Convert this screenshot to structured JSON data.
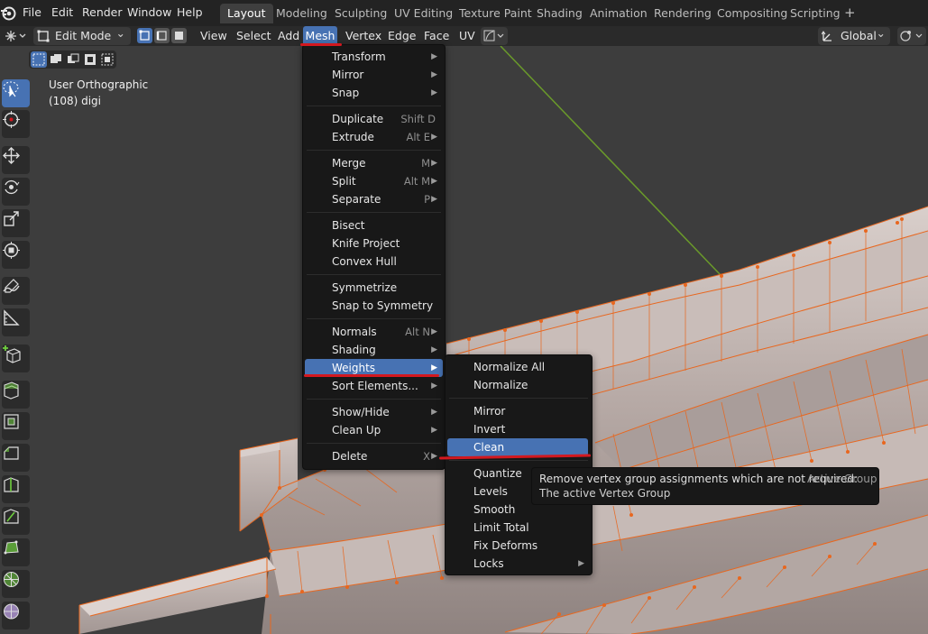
{
  "app_menu": {
    "items": [
      "File",
      "Edit",
      "Render",
      "Window",
      "Help"
    ]
  },
  "workspaces": {
    "tabs": [
      "Layout",
      "Modeling",
      "Sculpting",
      "UV Editing",
      "Texture Paint",
      "Shading",
      "Animation",
      "Rendering",
      "Compositing",
      "Scripting"
    ],
    "active": "Layout",
    "add_symbol": "+"
  },
  "header": {
    "mode": "Edit Mode",
    "view": "View",
    "select": "Select",
    "add": "Add",
    "mesh": "Mesh",
    "vertex": "Vertex",
    "edge": "Edge",
    "face": "Face",
    "uv": "UV",
    "orientation": "Global"
  },
  "viewport": {
    "view_name": "User Orthographic",
    "object_info": "(108) digi"
  },
  "mesh_menu": {
    "items": [
      {
        "label": "Transform",
        "shortcut": "",
        "submenu": true
      },
      {
        "label": "Mirror",
        "shortcut": "",
        "submenu": true
      },
      {
        "label": "Snap",
        "shortcut": "",
        "submenu": true
      },
      {
        "label": "Duplicate",
        "shortcut": "Shift D",
        "submenu": false
      },
      {
        "label": "Extrude",
        "shortcut": "Alt E",
        "submenu": true
      },
      {
        "label": "Merge",
        "shortcut": "M",
        "submenu": true
      },
      {
        "label": "Split",
        "shortcut": "Alt M",
        "submenu": true
      },
      {
        "label": "Separate",
        "shortcut": "P",
        "submenu": true
      },
      {
        "label": "Bisect",
        "shortcut": "",
        "submenu": false
      },
      {
        "label": "Knife Project",
        "shortcut": "",
        "submenu": false
      },
      {
        "label": "Convex Hull",
        "shortcut": "",
        "submenu": false
      },
      {
        "label": "Symmetrize",
        "shortcut": "",
        "submenu": false
      },
      {
        "label": "Snap to Symmetry",
        "shortcut": "",
        "submenu": false
      },
      {
        "label": "Normals",
        "shortcut": "Alt N",
        "submenu": true
      },
      {
        "label": "Shading",
        "shortcut": "",
        "submenu": true
      },
      {
        "label": "Weights",
        "shortcut": "",
        "submenu": true
      },
      {
        "label": "Sort Elements...",
        "shortcut": "",
        "submenu": true
      },
      {
        "label": "Show/Hide",
        "shortcut": "",
        "submenu": true
      },
      {
        "label": "Clean Up",
        "shortcut": "",
        "submenu": true
      },
      {
        "label": "Delete",
        "shortcut": "X",
        "submenu": true
      }
    ],
    "highlighted": "Weights"
  },
  "weights_menu": {
    "items": [
      {
        "label": "Normalize All",
        "submenu": false
      },
      {
        "label": "Normalize",
        "submenu": false
      },
      {
        "label": "Mirror",
        "submenu": false
      },
      {
        "label": "Invert",
        "submenu": false
      },
      {
        "label": "Clean",
        "submenu": false
      },
      {
        "label": "Quantize",
        "submenu": false
      },
      {
        "label": "Levels",
        "submenu": false
      },
      {
        "label": "Smooth",
        "submenu": false
      },
      {
        "label": "Limit Total",
        "submenu": false
      },
      {
        "label": "Fix Deforms",
        "submenu": false
      },
      {
        "label": "Locks",
        "submenu": true
      }
    ],
    "highlighted": "Clean"
  },
  "tooltip": {
    "line1": "Remove vertex group assignments which are not required:",
    "line1_value": "Active Group",
    "line2": "The active Vertex Group"
  },
  "icons": {
    "blender_logo": "blender-logo-icon",
    "editor_type": "3d-viewport-editor-icon",
    "submenu_arrow": "▶",
    "dropdown_arrow": "⌄"
  },
  "colors": {
    "accent_blue": "#4772b3",
    "annotation_red": "#d3181f",
    "mesh_wire": "#e8671f",
    "axis_green": "#6a9a2a",
    "menu_bg": "#181818",
    "topbar_bg": "#232323",
    "viewport_bg": "#3d3d3d"
  }
}
